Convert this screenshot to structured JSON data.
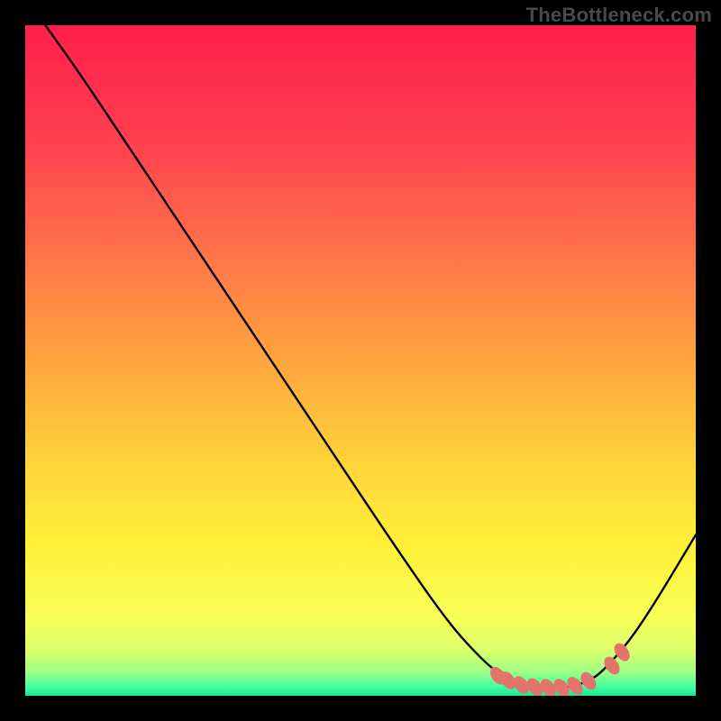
{
  "watermark": "TheBottleneck.com",
  "chart_data": {
    "type": "line",
    "title": "",
    "xlabel": "",
    "ylabel": "",
    "xlim": [
      0,
      100
    ],
    "ylim": [
      0,
      100
    ],
    "grid": false,
    "legend": false,
    "series": [
      {
        "name": "curve",
        "x": [
          3,
          8,
          15,
          25,
          35,
          45,
          55,
          63,
          68,
          71,
          73,
          75,
          78,
          80,
          82,
          84,
          86,
          90,
          94,
          100
        ],
        "y": [
          100,
          93,
          82.5,
          67.5,
          52.5,
          37.5,
          22.5,
          11,
          5.5,
          3,
          2,
          1.5,
          1.2,
          1.2,
          1.5,
          2.2,
          3.5,
          8,
          14,
          24
        ],
        "stroke": "#000000",
        "stroke_width": 2.4
      }
    ],
    "markers": [
      {
        "x": 70.5,
        "y": 3.0
      },
      {
        "x": 72.0,
        "y": 2.3
      },
      {
        "x": 74.0,
        "y": 1.6
      },
      {
        "x": 76.0,
        "y": 1.3
      },
      {
        "x": 78.0,
        "y": 1.2
      },
      {
        "x": 80.0,
        "y": 1.2
      },
      {
        "x": 82.0,
        "y": 1.5
      },
      {
        "x": 84.0,
        "y": 2.2
      },
      {
        "x": 87.5,
        "y": 4.5
      },
      {
        "x": 89.0,
        "y": 6.5
      }
    ],
    "marker_style": {
      "fill": "#e3746b",
      "rx": 7,
      "ry": 11,
      "tilt_deg": -35
    },
    "background_gradient": {
      "stops": [
        {
          "offset": 0.0,
          "color": "#ff1f4b"
        },
        {
          "offset": 0.18,
          "color": "#ff4150"
        },
        {
          "offset": 0.36,
          "color": "#ff7a48"
        },
        {
          "offset": 0.52,
          "color": "#ffab3d"
        },
        {
          "offset": 0.66,
          "color": "#ffd63a"
        },
        {
          "offset": 0.78,
          "color": "#fff13a"
        },
        {
          "offset": 0.88,
          "color": "#f8ff57"
        },
        {
          "offset": 0.93,
          "color": "#dfff6a"
        },
        {
          "offset": 0.965,
          "color": "#9cff87"
        },
        {
          "offset": 0.985,
          "color": "#4affa0"
        },
        {
          "offset": 1.0,
          "color": "#17e893"
        }
      ]
    }
  }
}
